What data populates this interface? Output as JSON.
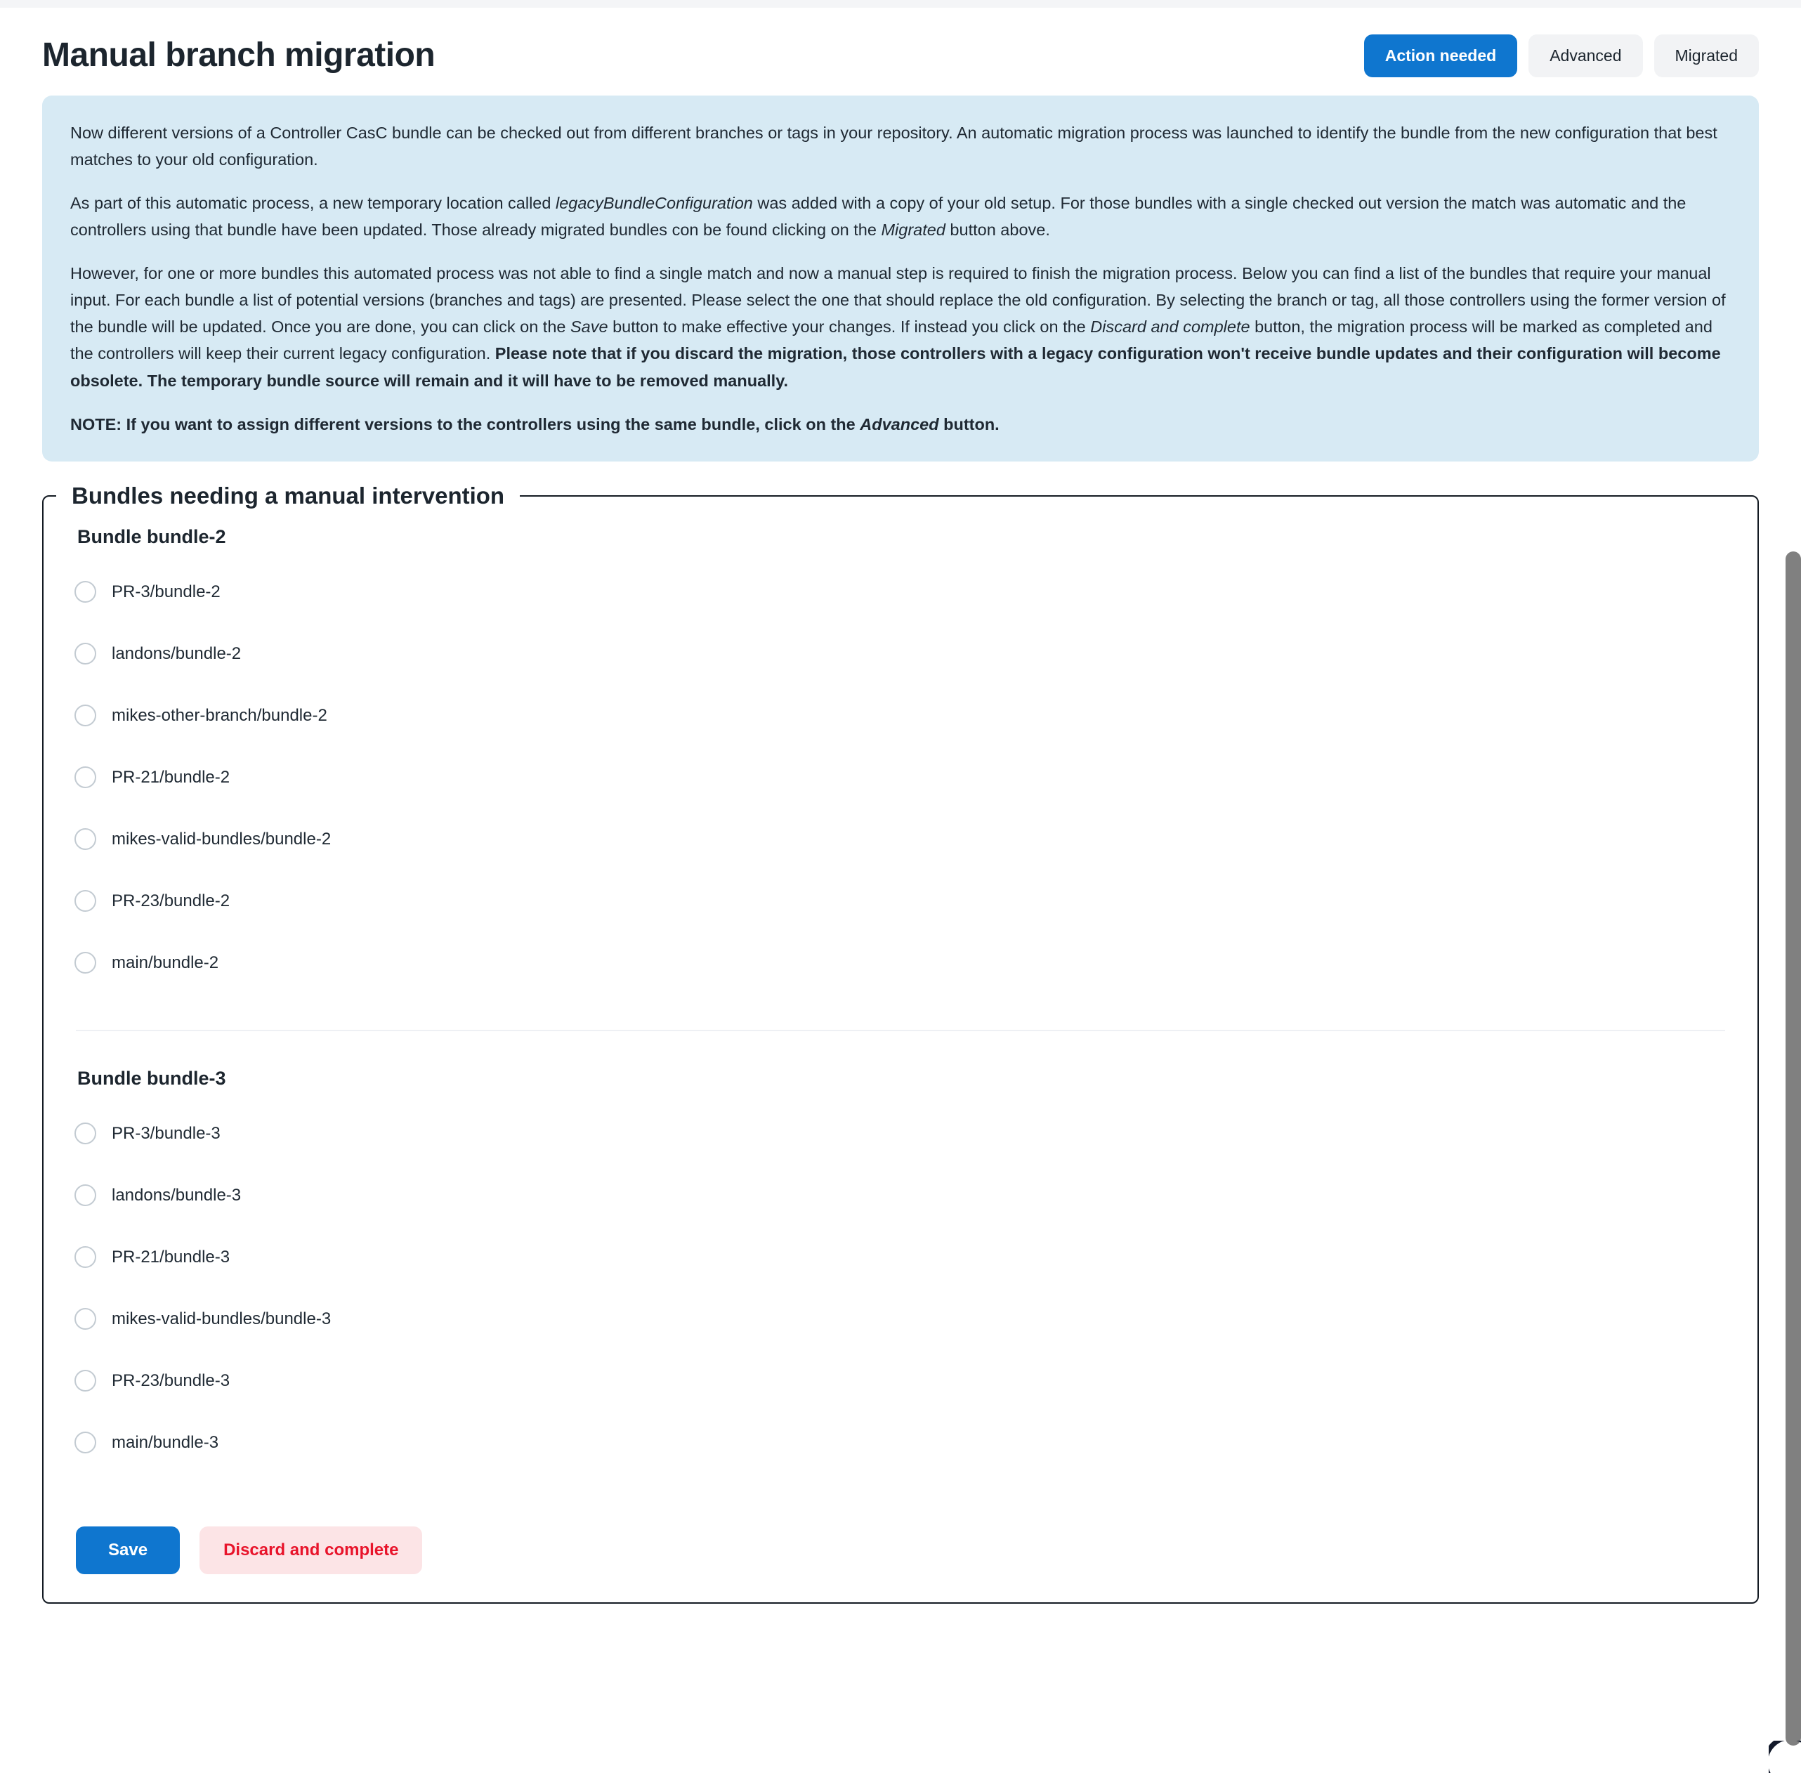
{
  "header": {
    "title": "Manual branch migration",
    "tabs": [
      {
        "label": "Action needed",
        "active": true
      },
      {
        "label": "Advanced",
        "active": false
      },
      {
        "label": "Migrated",
        "active": false
      }
    ]
  },
  "infobox": {
    "p1_a": "Now different versions of a Controller CasC bundle can be checked out from different branches or tags in your repository. An automatic migration process was launched to identify the bundle from the new configuration that best matches to your old configuration.",
    "p2_a": "As part of this automatic process, a new temporary location called ",
    "p2_em1": "legacyBundleConfiguration",
    "p2_b": " was added with a copy of your old setup. For those bundles with a single checked out version the match was automatic and the controllers using that bundle have been updated. Those already migrated bundles con be found clicking on the ",
    "p2_em2": "Migrated",
    "p2_c": " button above.",
    "p3_a": "However, for one or more bundles this automated process was not able to find a single match and now a manual step is required to finish the migration process. Below you can find a list of the bundles that require your manual input. For each bundle a list of potential versions (branches and tags) are presented. Please select the one that should replace the old configuration. By selecting the branch or tag, all those controllers using the former version of the bundle will be updated. Once you are done, you can click on the ",
    "p3_em1": "Save",
    "p3_b": " button to make effective your changes. If instead you click on the ",
    "p3_em2": "Discard and complete",
    "p3_c": " button, the migration process will be marked as completed and the controllers will keep their current legacy configuration. ",
    "p3_strong": "Please note that if you discard the migration, those controllers with a legacy configuration won't receive bundle updates and their configuration will become obsolete. The temporary bundle source will remain and it will have to be removed manually.",
    "p4_a": "NOTE: If you want to assign different versions to the controllers using the same bundle, click on the ",
    "p4_em": "Advanced",
    "p4_b": " button."
  },
  "fieldset": {
    "legend": "Bundles needing a manual intervention",
    "bundles": [
      {
        "title": "Bundle bundle-2",
        "options": [
          {
            "label": "PR-3/bundle-2",
            "selected": false
          },
          {
            "label": "landons/bundle-2",
            "selected": false
          },
          {
            "label": "mikes-other-branch/bundle-2",
            "selected": false
          },
          {
            "label": "PR-21/bundle-2",
            "selected": false
          },
          {
            "label": "mikes-valid-bundles/bundle-2",
            "selected": false
          },
          {
            "label": "PR-23/bundle-2",
            "selected": false
          },
          {
            "label": "main/bundle-2",
            "selected": false
          }
        ]
      },
      {
        "title": "Bundle bundle-3",
        "options": [
          {
            "label": "PR-3/bundle-3",
            "selected": false
          },
          {
            "label": "landons/bundle-3",
            "selected": false
          },
          {
            "label": "PR-21/bundle-3",
            "selected": false
          },
          {
            "label": "mikes-valid-bundles/bundle-3",
            "selected": false
          },
          {
            "label": "PR-23/bundle-3",
            "selected": false
          },
          {
            "label": "main/bundle-3",
            "selected": false
          }
        ]
      }
    ]
  },
  "actions": {
    "save_label": "Save",
    "discard_label": "Discard and complete"
  },
  "colors": {
    "accent": "#0f76cf",
    "info_bg": "#d7eaf4",
    "danger_text": "#e8142b",
    "danger_bg": "#fce4e6",
    "tab_bg": "#f2f3f5"
  }
}
